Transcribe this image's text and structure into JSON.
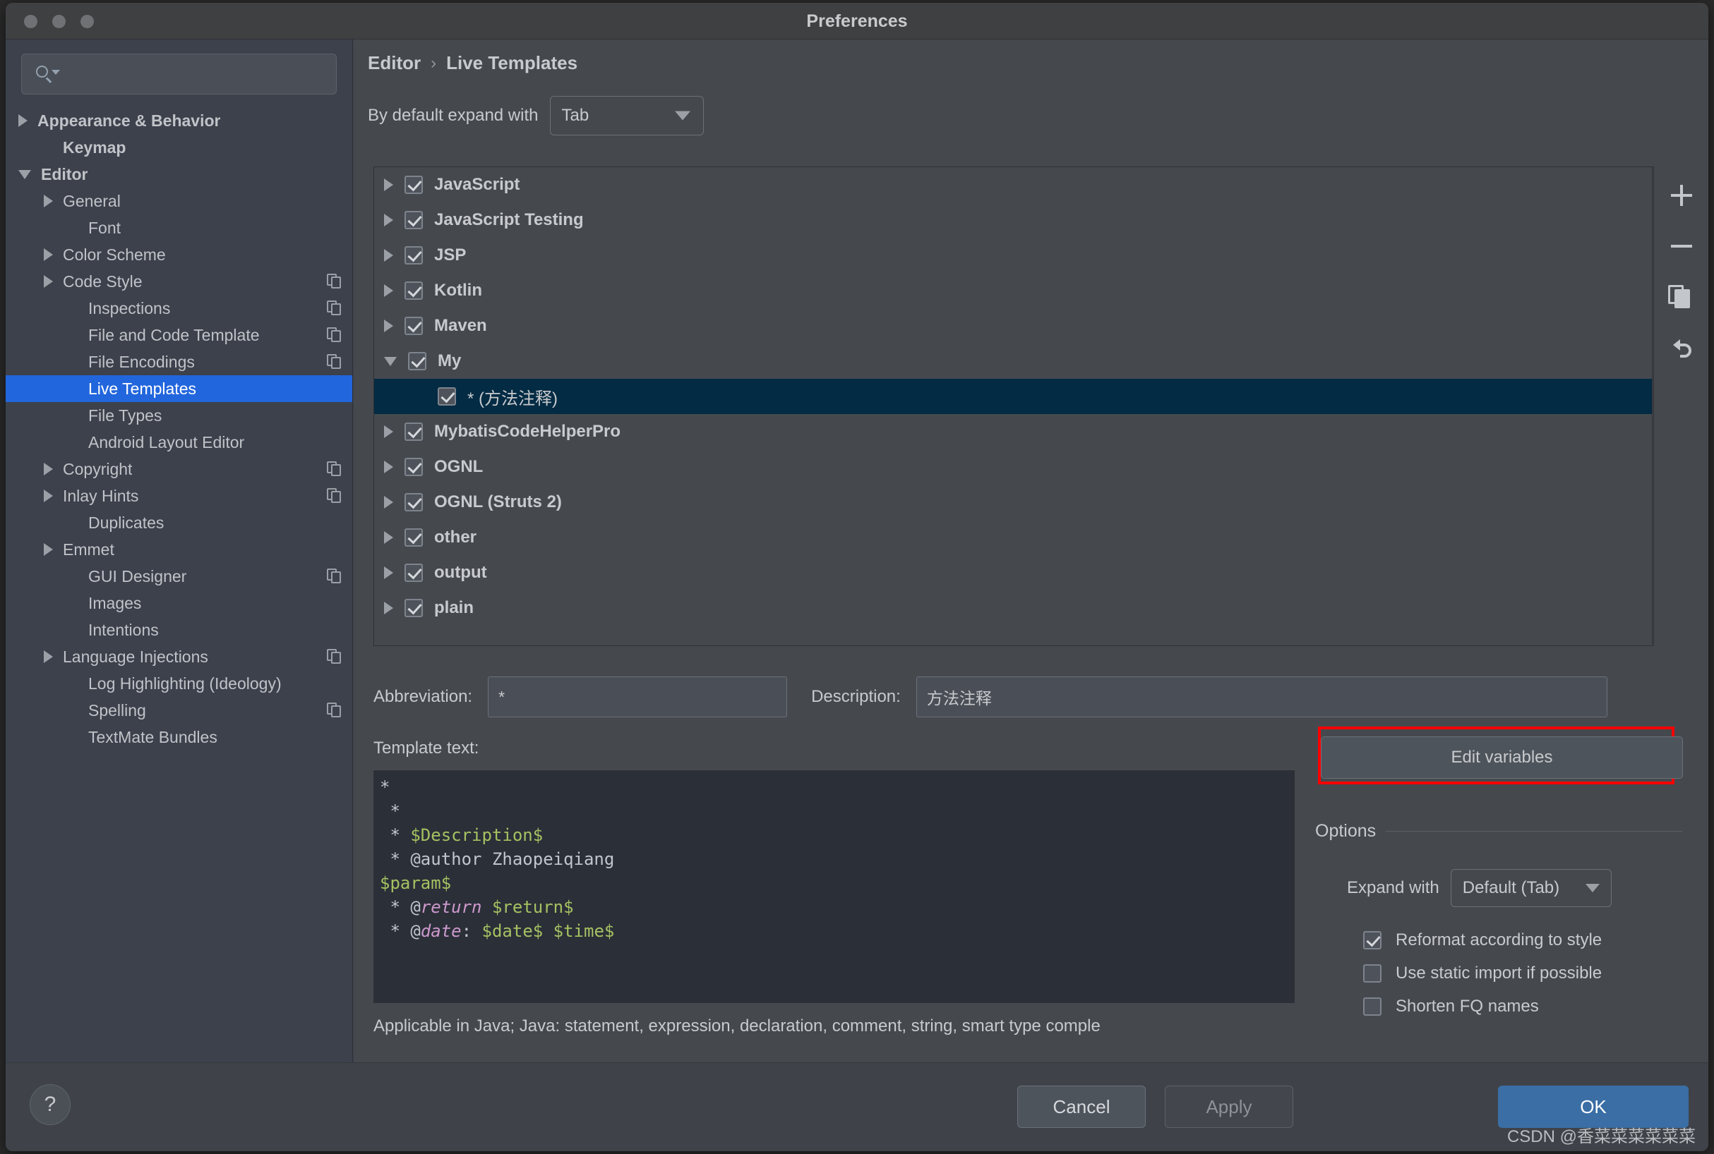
{
  "window": {
    "title": "Preferences"
  },
  "search": {
    "value": "",
    "placeholder": ""
  },
  "sidebar": {
    "items": [
      {
        "label": "Appearance & Behavior",
        "arrow": "right",
        "bold": true,
        "indent": 0,
        "copy": false,
        "selected": false
      },
      {
        "label": "Keymap",
        "arrow": "none",
        "bold": true,
        "indent": 1,
        "copy": false,
        "selected": false
      },
      {
        "label": "Editor",
        "arrow": "down",
        "bold": true,
        "indent": 0,
        "copy": false,
        "selected": false
      },
      {
        "label": "General",
        "arrow": "right",
        "bold": false,
        "indent": 1,
        "copy": false,
        "selected": false
      },
      {
        "label": "Font",
        "arrow": "none",
        "bold": false,
        "indent": 2,
        "copy": false,
        "selected": false
      },
      {
        "label": "Color Scheme",
        "arrow": "right",
        "bold": false,
        "indent": 1,
        "copy": false,
        "selected": false
      },
      {
        "label": "Code Style",
        "arrow": "right",
        "bold": false,
        "indent": 1,
        "copy": true,
        "selected": false
      },
      {
        "label": "Inspections",
        "arrow": "none",
        "bold": false,
        "indent": 2,
        "copy": true,
        "selected": false
      },
      {
        "label": "File and Code Template",
        "arrow": "none",
        "bold": false,
        "indent": 2,
        "copy": true,
        "selected": false
      },
      {
        "label": "File Encodings",
        "arrow": "none",
        "bold": false,
        "indent": 2,
        "copy": true,
        "selected": false
      },
      {
        "label": "Live Templates",
        "arrow": "none",
        "bold": false,
        "indent": 2,
        "copy": false,
        "selected": true
      },
      {
        "label": "File Types",
        "arrow": "none",
        "bold": false,
        "indent": 2,
        "copy": false,
        "selected": false
      },
      {
        "label": "Android Layout Editor",
        "arrow": "none",
        "bold": false,
        "indent": 2,
        "copy": false,
        "selected": false
      },
      {
        "label": "Copyright",
        "arrow": "right",
        "bold": false,
        "indent": 1,
        "copy": true,
        "selected": false
      },
      {
        "label": "Inlay Hints",
        "arrow": "right",
        "bold": false,
        "indent": 1,
        "copy": true,
        "selected": false
      },
      {
        "label": "Duplicates",
        "arrow": "none",
        "bold": false,
        "indent": 2,
        "copy": false,
        "selected": false
      },
      {
        "label": "Emmet",
        "arrow": "right",
        "bold": false,
        "indent": 1,
        "copy": false,
        "selected": false
      },
      {
        "label": "GUI Designer",
        "arrow": "none",
        "bold": false,
        "indent": 2,
        "copy": true,
        "selected": false
      },
      {
        "label": "Images",
        "arrow": "none",
        "bold": false,
        "indent": 2,
        "copy": false,
        "selected": false
      },
      {
        "label": "Intentions",
        "arrow": "none",
        "bold": false,
        "indent": 2,
        "copy": false,
        "selected": false
      },
      {
        "label": "Language Injections",
        "arrow": "right",
        "bold": false,
        "indent": 1,
        "copy": true,
        "selected": false
      },
      {
        "label": "Log Highlighting (Ideology)",
        "arrow": "none",
        "bold": false,
        "indent": 2,
        "copy": false,
        "selected": false
      },
      {
        "label": "Spelling",
        "arrow": "none",
        "bold": false,
        "indent": 2,
        "copy": true,
        "selected": false
      },
      {
        "label": "TextMate Bundles",
        "arrow": "none",
        "bold": false,
        "indent": 2,
        "copy": false,
        "selected": false
      }
    ]
  },
  "breadcrumb": {
    "parent": "Editor",
    "separator": "›",
    "current": "Live Templates"
  },
  "expand_default": {
    "label": "By default expand with",
    "value": "Tab"
  },
  "templates": {
    "rows": [
      {
        "label": "JavaScript",
        "arrow": "right",
        "checked": true,
        "child": false,
        "selected": false
      },
      {
        "label": "JavaScript Testing",
        "arrow": "right",
        "checked": true,
        "child": false,
        "selected": false
      },
      {
        "label": "JSP",
        "arrow": "right",
        "checked": true,
        "child": false,
        "selected": false
      },
      {
        "label": "Kotlin",
        "arrow": "right",
        "checked": true,
        "child": false,
        "selected": false
      },
      {
        "label": "Maven",
        "arrow": "right",
        "checked": true,
        "child": false,
        "selected": false
      },
      {
        "label": "My",
        "arrow": "down",
        "checked": true,
        "child": false,
        "selected": false
      },
      {
        "label": "* (方法注释)",
        "arrow": "none",
        "checked": true,
        "child": true,
        "selected": true
      },
      {
        "label": "MybatisCodeHelperPro",
        "arrow": "right",
        "checked": true,
        "child": false,
        "selected": false
      },
      {
        "label": "OGNL",
        "arrow": "right",
        "checked": true,
        "child": false,
        "selected": false
      },
      {
        "label": "OGNL (Struts 2)",
        "arrow": "right",
        "checked": true,
        "child": false,
        "selected": false
      },
      {
        "label": "other",
        "arrow": "right",
        "checked": true,
        "child": false,
        "selected": false
      },
      {
        "label": "output",
        "arrow": "right",
        "checked": true,
        "child": false,
        "selected": false
      },
      {
        "label": "plain",
        "arrow": "right",
        "checked": true,
        "child": false,
        "selected": false
      }
    ],
    "toolbar": [
      {
        "name": "add",
        "icon": "plus-icon"
      },
      {
        "name": "remove",
        "icon": "minus-icon"
      },
      {
        "name": "duplicate",
        "icon": "copy-icon"
      },
      {
        "name": "revert",
        "icon": "undo-icon"
      }
    ]
  },
  "detail": {
    "abbreviation_label": "Abbreviation:",
    "abbreviation_value": "*",
    "description_label": "Description:",
    "description_value": "方法注释",
    "template_text_label": "Template text:",
    "template_lines": [
      {
        "parts": [
          {
            "t": "*",
            "c": ""
          }
        ]
      },
      {
        "parts": [
          {
            "t": " *",
            "c": ""
          }
        ]
      },
      {
        "parts": [
          {
            "t": " * ",
            "c": ""
          },
          {
            "t": "$Description$",
            "c": "g"
          }
        ]
      },
      {
        "parts": [
          {
            "t": " * @author Zhaopeiqiang",
            "c": ""
          }
        ]
      },
      {
        "parts": [
          {
            "t": "$param$",
            "c": "g"
          }
        ]
      },
      {
        "parts": [
          {
            "t": " * ",
            "c": ""
          },
          {
            "t": "@",
            "c": ""
          },
          {
            "t": "return",
            "c": "p"
          },
          {
            "t": " ",
            "c": ""
          },
          {
            "t": "$return$",
            "c": "g"
          }
        ]
      },
      {
        "parts": [
          {
            "t": " * ",
            "c": ""
          },
          {
            "t": "@",
            "c": ""
          },
          {
            "t": "date",
            "c": "p"
          },
          {
            "t": ": ",
            "c": ""
          },
          {
            "t": "$date$ $time$",
            "c": "g"
          }
        ]
      }
    ],
    "applicable": "Applicable in Java; Java: statement, expression, declaration, comment, string, smart type comple"
  },
  "options": {
    "edit_variables_label": "Edit variables",
    "header": "Options",
    "expand_with_label": "Expand with",
    "expand_with_value": "Default (Tab)",
    "checkboxes": [
      {
        "label": "Reformat according to style",
        "checked": true
      },
      {
        "label": "Use static import if possible",
        "checked": false
      },
      {
        "label": "Shorten FQ names",
        "checked": false
      }
    ]
  },
  "footer": {
    "help_label": "?",
    "cancel_label": "Cancel",
    "apply_label": "Apply",
    "ok_label": "OK",
    "watermark": "CSDN @香菜菜菜菜菜菜"
  },
  "colors": {
    "sidebar_selection": "#2266dd",
    "list_selection": "#032b44",
    "ok_button": "#3a6ea5",
    "annotation_box": "#ff0000",
    "template_var": "#a5c261",
    "template_tag": "#cc99cc"
  }
}
